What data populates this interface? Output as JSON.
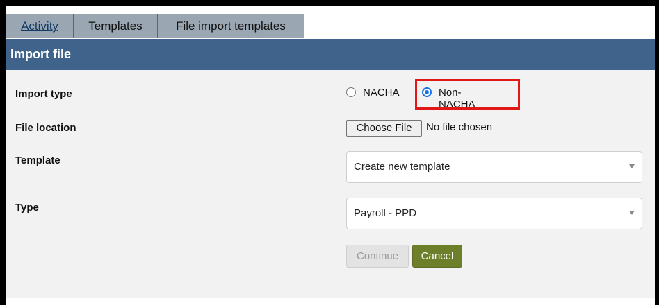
{
  "tabs": [
    {
      "label": "Activity"
    },
    {
      "label": "Templates"
    },
    {
      "label": "File import templates"
    }
  ],
  "section": {
    "title": "Import file"
  },
  "form": {
    "import_type": {
      "label": "Import type",
      "options": [
        {
          "label": "NACHA",
          "selected": false
        },
        {
          "label": "Non-NACHA",
          "selected": true
        }
      ]
    },
    "file_location": {
      "label": "File location",
      "button_label": "Choose File",
      "status": "No file chosen"
    },
    "template": {
      "label": "Template",
      "value": "Create new template"
    },
    "type": {
      "label": "Type",
      "value": "Payroll - PPD"
    }
  },
  "actions": {
    "continue_label": "Continue",
    "cancel_label": "Cancel"
  },
  "colors": {
    "header_bg": "#3f638a",
    "tab_bg": "#9aa7b2",
    "cancel_bg": "#6e7f2c",
    "highlight": "#e01818"
  }
}
